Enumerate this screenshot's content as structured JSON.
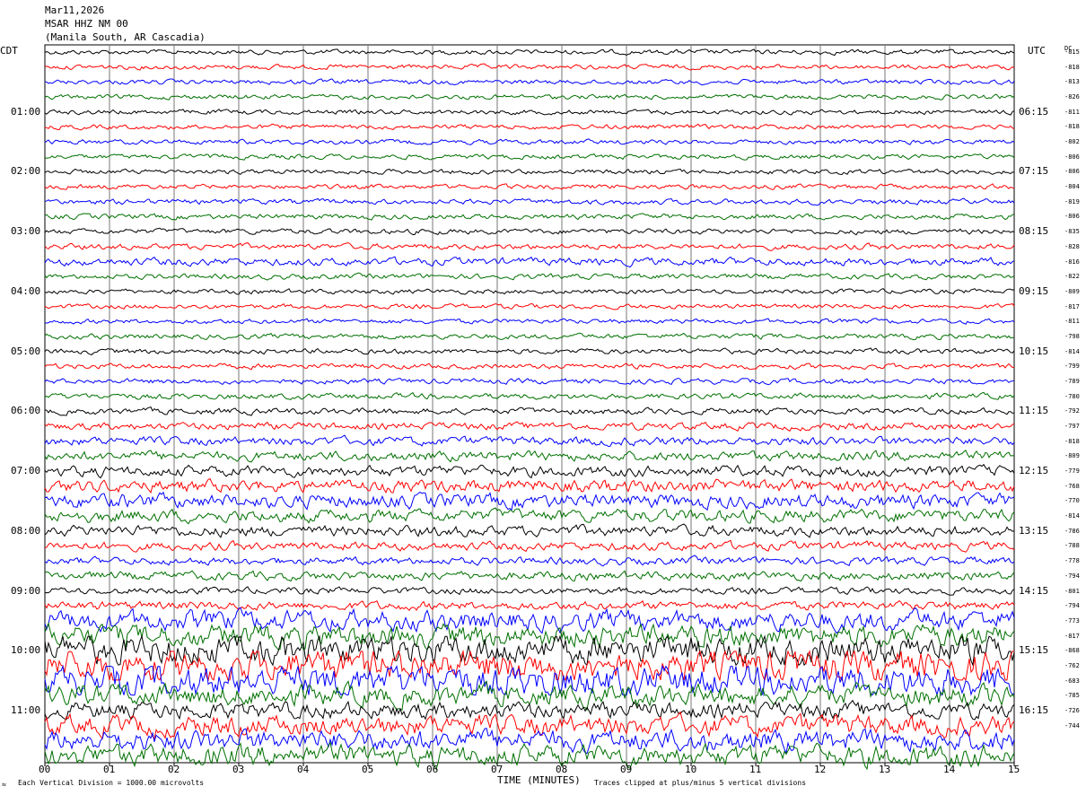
{
  "header": {
    "date": "Mar11,2026",
    "station": "MSAR HHZ NM 00",
    "location": "(Manila South, AR Cascadia)"
  },
  "left_label": "CDT",
  "right_label": "UTC",
  "dc_label": "DC",
  "footer": {
    "xlabel": "TIME (MINUTES)",
    "scale_note": "Each Vertical Division = 1000.00 microvolts",
    "clip_note": "Traces clipped at plus/minus 5 vertical divisions",
    "corner_mark": "≈"
  },
  "chart_data": {
    "type": "line",
    "title": "MSAR HHZ NM 00",
    "xlabel": "TIME (MINUTES)",
    "xlim": [
      0,
      15
    ],
    "x_ticks": [
      "00",
      "01",
      "02",
      "03",
      "04",
      "05",
      "06",
      "07",
      "08",
      "09",
      "10",
      "11",
      "12",
      "13",
      "14",
      "15"
    ],
    "left_hour_labels": [
      "01:00",
      "02:00",
      "03:00",
      "04:00",
      "05:00",
      "06:00",
      "07:00",
      "08:00",
      "09:00",
      "10:00",
      "11:00"
    ],
    "right_hour_labels": [
      "06:15",
      "07:15",
      "08:15",
      "09:15",
      "10:15",
      "11:15",
      "12:15",
      "13:15",
      "14:15",
      "15:15",
      "16:15"
    ],
    "trace_colors": [
      "#000000",
      "#ff0000",
      "#0000ff",
      "#007000"
    ],
    "trace_count": 48,
    "dc_offsets": [
      "-815",
      "-818",
      "-813",
      "-826",
      "-811",
      "-818",
      "-802",
      "-806",
      "-806",
      "-804",
      "-819",
      "-806",
      "-835",
      "-828",
      "-816",
      "-822",
      "-809",
      "-817",
      "-811",
      "-798",
      "-814",
      "-799",
      "-789",
      "-780",
      "-792",
      "-797",
      "-818",
      "-809",
      "-779",
      "-768",
      "-770",
      "-814",
      "-786",
      "-788",
      "-778",
      "-794",
      "-801",
      "-794",
      "-773",
      "-817",
      "-868",
      "-762",
      "-683",
      "-785",
      "-726",
      "-744"
    ],
    "amplitude_levels": [
      1.0,
      1.0,
      1.0,
      1.0,
      1.0,
      1.0,
      1.0,
      1.0,
      1.0,
      1.0,
      1.1,
      1.1,
      1.1,
      1.2,
      1.6,
      1.1,
      1.0,
      1.0,
      1.0,
      1.1,
      1.1,
      1.1,
      1.1,
      1.2,
      1.3,
      1.5,
      1.8,
      2.0,
      2.2,
      2.6,
      3.0,
      2.6,
      2.2,
      1.8,
      1.6,
      1.8,
      1.4,
      1.8,
      4.2,
      4.6,
      6.0,
      6.6,
      6.4,
      4.4,
      3.4,
      4.2,
      4.4,
      4.4
    ]
  }
}
